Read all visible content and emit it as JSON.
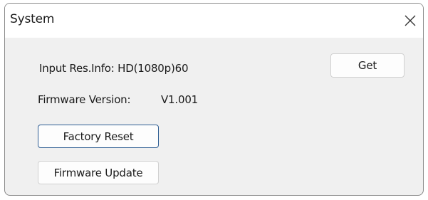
{
  "window": {
    "title": "System"
  },
  "info": {
    "input_res_label": "Input Res.Info: HD(1080p)60",
    "firmware_version_label": "Firmware Version:",
    "firmware_version_value": "V1.001"
  },
  "buttons": {
    "get": "Get",
    "factory_reset": "Factory Reset",
    "firmware_update": "Firmware Update"
  },
  "icons": {
    "close": "close-icon"
  }
}
